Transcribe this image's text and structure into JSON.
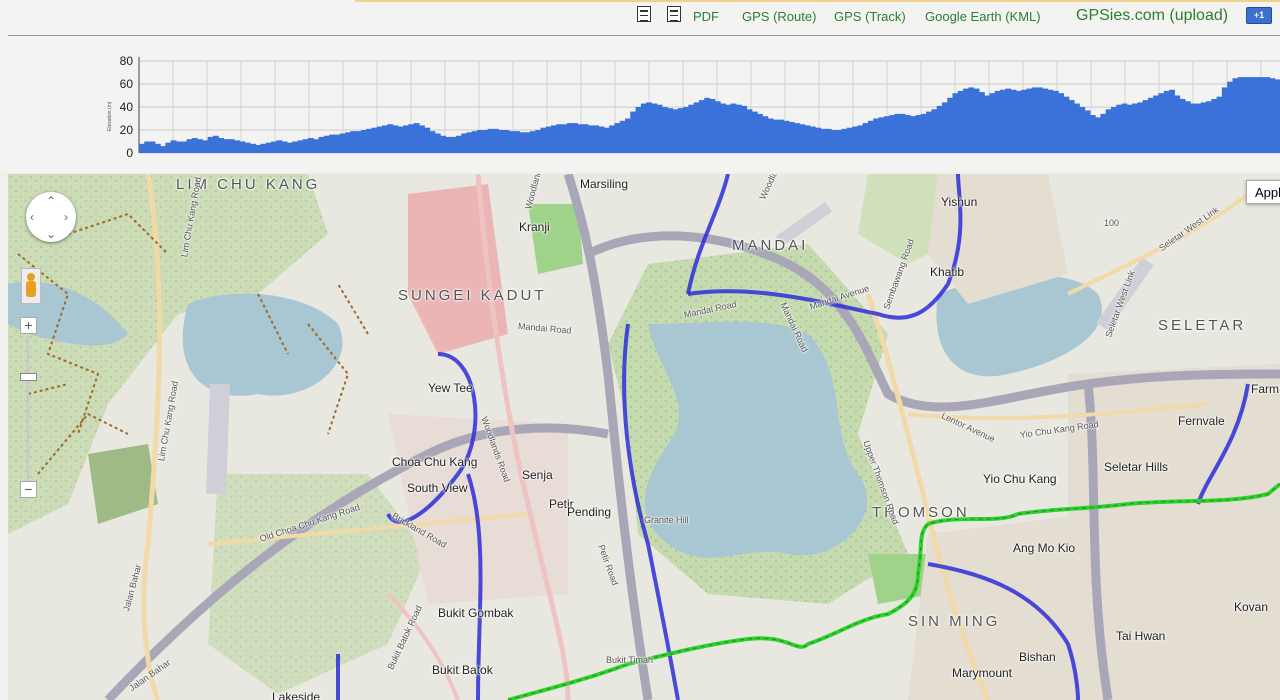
{
  "toolbar": {
    "links": [
      "PDF",
      "GPS (Route)",
      "GPS (Track)",
      "Google Earth (KML)"
    ],
    "gpsies_label": "GPSies.com (upload)",
    "gplus_label": "+1"
  },
  "chart_data": {
    "type": "area",
    "title": "",
    "xlabel": "",
    "ylabel": "Elevation (m)",
    "ylim": [
      0,
      80
    ],
    "y_ticks": [
      0,
      20,
      40,
      60,
      80
    ],
    "grid": true,
    "color": "#3b72d9",
    "values": [
      8,
      10,
      10,
      8,
      6,
      9,
      11,
      10,
      10,
      12,
      13,
      12,
      11,
      14,
      15,
      13,
      12,
      12,
      11,
      10,
      9,
      8,
      7,
      8,
      9,
      10,
      11,
      10,
      9,
      10,
      11,
      12,
      13,
      12,
      14,
      15,
      16,
      16,
      17,
      18,
      19,
      19,
      20,
      21,
      22,
      23,
      24,
      25,
      24,
      23,
      24,
      25,
      26,
      24,
      22,
      19,
      17,
      15,
      14,
      14,
      15,
      17,
      18,
      19,
      20,
      20,
      21,
      21,
      20,
      20,
      19,
      19,
      18,
      18,
      19,
      20,
      22,
      23,
      24,
      25,
      25,
      26,
      26,
      25,
      25,
      24,
      24,
      23,
      22,
      24,
      26,
      28,
      30,
      36,
      40,
      43,
      44,
      43,
      42,
      40,
      39,
      38,
      39,
      40,
      42,
      44,
      46,
      48,
      47,
      45,
      43,
      42,
      43,
      42,
      41,
      38,
      36,
      34,
      32,
      30,
      29,
      29,
      28,
      27,
      26,
      25,
      24,
      23,
      22,
      21,
      21,
      20,
      20,
      21,
      22,
      23,
      24,
      26,
      28,
      30,
      31,
      32,
      33,
      34,
      34,
      33,
      32,
      33,
      34,
      36,
      38,
      41,
      44,
      48,
      52,
      54,
      56,
      57,
      56,
      53,
      50,
      52,
      54,
      55,
      56,
      55,
      54,
      55,
      56,
      57,
      57,
      56,
      55,
      54,
      52,
      49,
      46,
      43,
      40,
      37,
      33,
      31,
      34,
      38,
      40,
      42,
      43,
      42,
      43,
      44,
      46,
      48,
      50,
      52,
      54,
      55,
      50,
      47,
      45,
      43,
      43,
      44,
      45,
      47,
      49,
      57,
      62,
      65,
      66,
      66,
      66,
      66,
      66,
      66,
      65,
      64
    ]
  },
  "map": {
    "area_labels": [
      "LIM CHU KANG",
      "SUNGEI KADUT",
      "MANDAI",
      "SELETAR",
      "THOMSON",
      "SIN MING"
    ],
    "place_labels": [
      "Marsiling",
      "Kranji",
      "Yishun",
      "Khatib",
      "Yew Tee",
      "Choa Chu Kang",
      "South View",
      "Senja",
      "Petir",
      "Pending",
      "Fernvale",
      "Yio Chu Kang",
      "Seletar Hills",
      "Ang Mo Kio",
      "Bukit Gombak",
      "Bukit Batok",
      "Bishan",
      "Tai Hwan",
      "Marymount",
      "Kovan",
      "Lakeside",
      "Farm",
      "Granite Hill",
      "Bukit Timah"
    ],
    "road_labels": [
      "Lim Chu Kang Road",
      "Lim Chu Kang Road",
      "Mandai Road",
      "Mandai Road",
      "Mandai Avenue",
      "Sembawang Road",
      "Seletar West Link",
      "Seletar West Link",
      "Lentor Avenue",
      "Yio Chu Kang Road",
      "Upper Thomson Road",
      "Old Choa Chu Kang Road",
      "Brickland Road",
      "Woodlands Road",
      "Petir Road",
      "Bukit Batok Road",
      "Jalan Bahar",
      "Jalan Bahar",
      "Mandai Road",
      "Woodlands",
      "Woodlands",
      "100"
    ],
    "map_type_label": "Appl",
    "zoom_in": "+",
    "zoom_out": "−"
  }
}
